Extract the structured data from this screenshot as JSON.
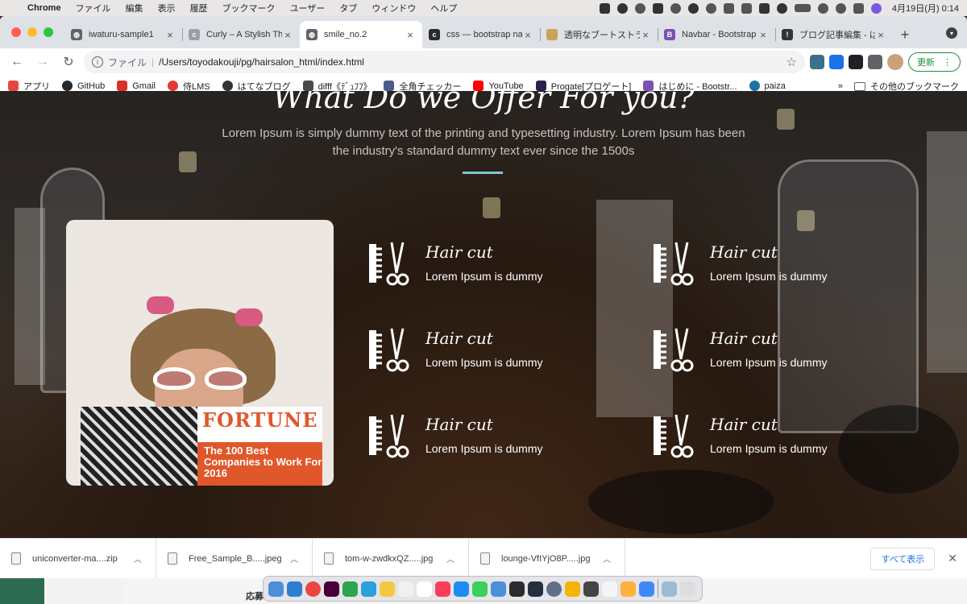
{
  "menubar": {
    "app": "Chrome",
    "items": [
      "ファイル",
      "編集",
      "表示",
      "履歴",
      "ブックマーク",
      "ユーザー",
      "タブ",
      "ウィンドウ",
      "ヘルプ"
    ],
    "clock": "4月19日(月)  0:14"
  },
  "tabs": [
    {
      "title": "iwaturu-sample1",
      "icon": "globe-icon",
      "color": "#5f6368",
      "glyph": "◍"
    },
    {
      "title": "Curly – A Stylish Th",
      "icon": "page-c-icon",
      "color": "#9aa0a6",
      "glyph": "c"
    },
    {
      "title": "smile_no.2",
      "icon": "globe-icon",
      "color": "#5f6368",
      "glyph": "◍",
      "active": true
    },
    {
      "title": "css — bootstrap na",
      "icon": "css-icon",
      "color": "#2b2b2b",
      "glyph": "c"
    },
    {
      "title": "透明なブートストラッ",
      "icon": "folder-icon",
      "color": "#c9a25a",
      "glyph": ""
    },
    {
      "title": "Navbar - Bootstrap",
      "icon": "bootstrap-icon",
      "color": "#7952b3",
      "glyph": "B"
    },
    {
      "title": "ブログ記事編集 - はて",
      "icon": "hatena-icon",
      "color": "#333333",
      "glyph": "!"
    }
  ],
  "toolbar": {
    "scheme": "ファイル",
    "url": "/Users/toyodakouji/pg/hairsalon_html/index.html",
    "update_label": "更新"
  },
  "bookmarks": [
    {
      "label": "アプリ",
      "icon": "apps-grid-icon",
      "color": "#e8453c"
    },
    {
      "label": "GitHub",
      "icon": "github-icon",
      "color": "#24292e"
    },
    {
      "label": "Gmail",
      "icon": "gmail-icon",
      "color": "#d93025"
    },
    {
      "label": "侍LMS",
      "icon": "samurai-icon",
      "color": "#e53935"
    },
    {
      "label": "はてなブログ",
      "icon": "hatena-icon",
      "color": "#333333"
    },
    {
      "label": "difff《ﾃﾞｭﾌﾌ》",
      "icon": "difff-icon",
      "color": "#4a4a4a"
    },
    {
      "label": "全角チェッカー",
      "icon": "checker-icon",
      "color": "#4a5b8c"
    },
    {
      "label": "YouTube",
      "icon": "youtube-icon",
      "color": "#ff0000"
    },
    {
      "label": "Progate[プロゲート]",
      "icon": "progate-icon",
      "color": "#2b1f4f"
    },
    {
      "label": "はじめに - Bootstr...",
      "icon": "bootstrap-icon",
      "color": "#7952b3"
    },
    {
      "label": "paiza",
      "icon": "paiza-icon",
      "color": "#1a73a8"
    }
  ],
  "bookmarks_more": "»",
  "other_bookmarks": "その他のブックマーク",
  "page": {
    "heading": "What Do we Offer For you?",
    "subtitle": "Lorem Ipsum is simply dummy text of the printing and typesetting industry. Lorem Ipsum has been the industry's standard dummy text ever since the 1500s",
    "magazine_title": "FORTUNE",
    "magazine_cover": "The 100 Best Companies to Work For 2016",
    "services": [
      {
        "title": "Hair cut",
        "desc": "Lorem Ipsum is dummy"
      },
      {
        "title": "Hair cut",
        "desc": "Lorem Ipsum is dummy"
      },
      {
        "title": "Hair cut",
        "desc": "Lorem Ipsum is dummy"
      },
      {
        "title": "Hair cut",
        "desc": "Lorem Ipsum is dummy"
      },
      {
        "title": "Hair cut",
        "desc": "Lorem Ipsum is dummy"
      },
      {
        "title": "Hair cut",
        "desc": "Lorem Ipsum is dummy"
      }
    ]
  },
  "downloads": {
    "items": [
      "uniconverter-ma....zip",
      "Free_Sample_B.....jpeg",
      "tom-w-zwdkxQZ.....jpg",
      "lounge-VfIYjO8P.....jpg"
    ],
    "show_all": "すべて表示"
  },
  "desktop": {
    "behind_text": "応募"
  },
  "dock_colors": [
    "#4a90d9",
    "#2d7dd2",
    "#e9473f",
    "#470137",
    "#2ea44f",
    "#2aa0dd",
    "#f5c842",
    "#f0f0f0",
    "#ffffff",
    "#fb3c5b",
    "#1c8cf0",
    "#3ccf5a",
    "#4a90d9",
    "#2b2b2b",
    "#232f3e",
    "#5f6f86",
    "#f4b400",
    "#444444",
    "#f5f5f5",
    "#ffb13b",
    "#3d8af7",
    "#9bbbd4",
    "#dddddd"
  ]
}
